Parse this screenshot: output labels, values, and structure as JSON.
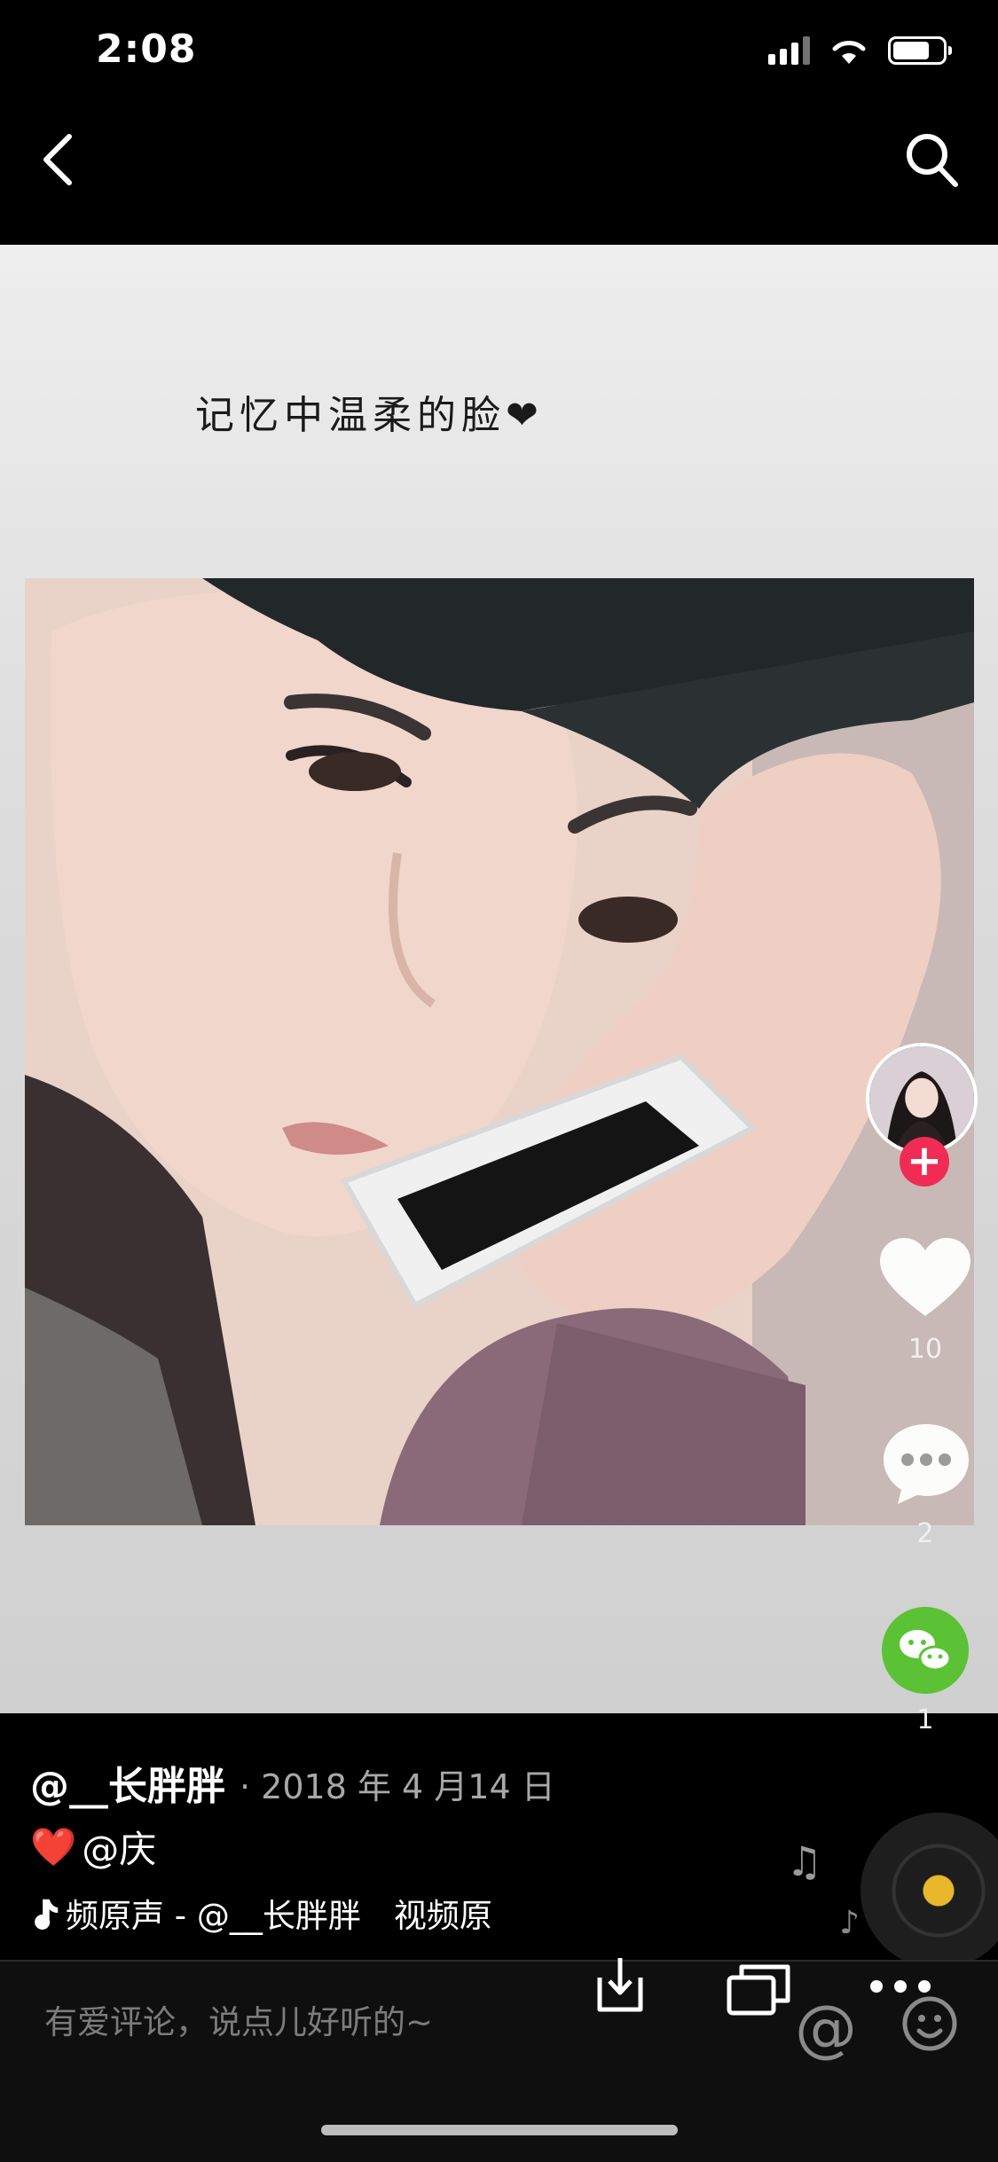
{
  "status_bar": {
    "time": "2:08"
  },
  "nav": {
    "back_icon": "back-chevron-icon",
    "search_icon": "search-icon"
  },
  "post": {
    "caption_text": "记忆中温柔的脸❤",
    "like_count": "10",
    "comment_count": "2",
    "share_count": "1",
    "author": "@__长胖胖",
    "date": "· 2018 年 4 月14 日",
    "desc_heart": "❤️",
    "desc_mention": "@庆",
    "music": "频原声 - @__长胖胖　视频原"
  },
  "comment_bar": {
    "placeholder": "有爱评论，说点儿好听的~",
    "at_symbol": "@"
  },
  "colors": {
    "follow": "#f12c54",
    "wechat": "#5bc236",
    "record_center": "#e8b82a"
  }
}
